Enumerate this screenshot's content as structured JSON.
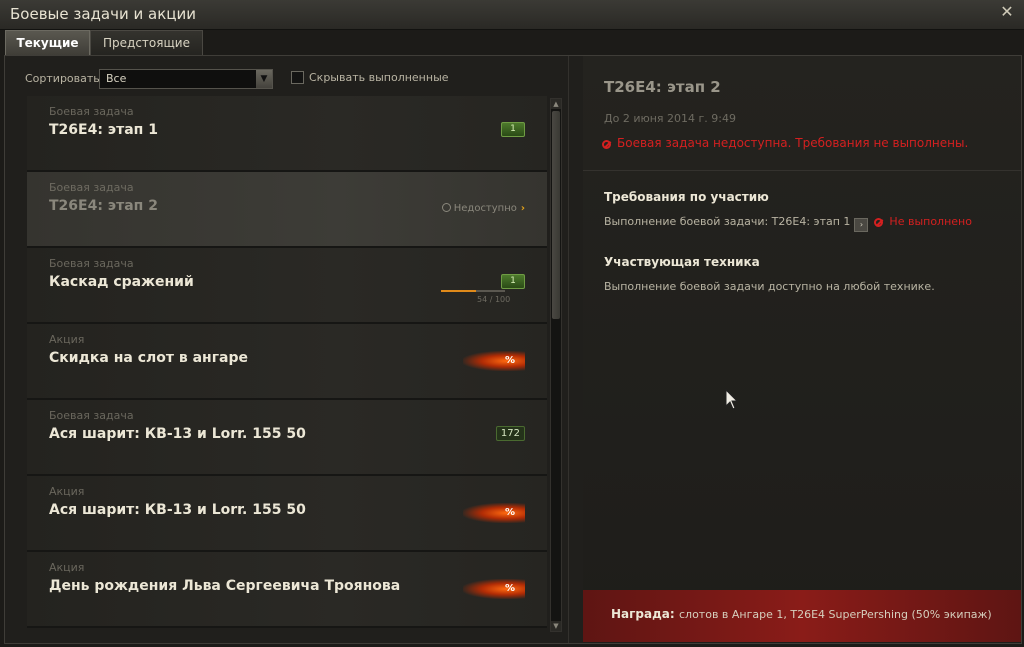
{
  "window": {
    "title": "Боевые задачи и акции",
    "close": "✕"
  },
  "tabs": [
    {
      "label": "Текущие",
      "active": true
    },
    {
      "label": "Предстоящие",
      "active": false
    }
  ],
  "filters": {
    "sort_label": "Сортировать:",
    "sort_value": "Все",
    "hide_completed_label": "Скрывать выполненные",
    "hide_completed_checked": false
  },
  "list": {
    "items": [
      {
        "type": "Боевая задача",
        "name": "T26E4: этап 1",
        "badge": "1"
      },
      {
        "type": "Боевая задача",
        "name": "T26E4: этап 2",
        "status": "Недоступно",
        "arrow": "›"
      },
      {
        "type": "Боевая задача",
        "name": "Каскад сражений",
        "badge": "1",
        "progress": "54 / 100",
        "progress_value": 54,
        "progress_max": 100
      },
      {
        "type": "Акция",
        "name": "Скидка на слот в ангаре",
        "promo": "%"
      },
      {
        "type": "Боевая задача",
        "name": "Ася шарит: КВ-13 и Lorr. 155 50",
        "badge": "172"
      },
      {
        "type": "Акция",
        "name": "Ася шарит: КВ-13 и Lorr. 155 50",
        "promo": "%"
      },
      {
        "type": "Акция",
        "name": "День рождения Льва Сергеевича Троянова",
        "promo": "%"
      }
    ]
  },
  "detail": {
    "title": "T26E4: этап 2",
    "deadline": "До 2 июня 2014 г. 9:49",
    "warning": "Боевая задача недоступна. Требования не выполнены.",
    "requirements_title": "Требования по участию",
    "requirement_text": "Выполнение боевой задачи: T26E4: этап 1",
    "requirement_button": "›",
    "requirement_status": "Не выполнено",
    "vehicles_title": "Участвующая техника",
    "vehicles_text": "Выполнение боевой задачи доступно на любой технике.",
    "reward_label": "Награда:",
    "reward_text": "слотов в Ангаре 1, T26E4 SuperPershing (50% экипаж)"
  }
}
